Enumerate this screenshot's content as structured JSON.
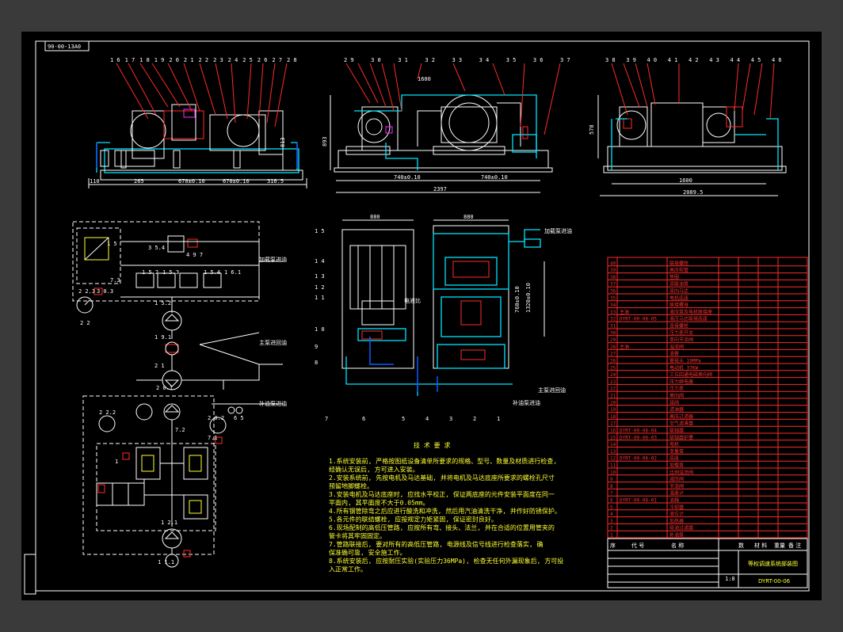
{
  "drawing": {
    "code_tag": "90-00-13A0",
    "title": "等权调速系统部装图",
    "number": "DYRT-00-06",
    "scale": "1:8"
  },
  "views": {
    "front_labels": [
      "1 6",
      "1 7",
      "1 8",
      "1 9",
      "2 0",
      "2 1",
      "2 2",
      "2 3",
      "2 4",
      "2 5",
      "2 6",
      "2 7",
      "2 8"
    ],
    "front_dims": [
      "110",
      "265",
      "670±0.10",
      "670±0.10",
      "316.5"
    ],
    "front_height": "813",
    "side_labels": [
      "2 9",
      "3 0",
      "3 1",
      "3 2",
      "3 3",
      "3 4",
      "3 5",
      "3 6",
      "3 7"
    ],
    "side_dims": [
      "1600",
      "740±0.10",
      "740±0.10",
      "2397"
    ],
    "side_height": "893",
    "right_labels": [
      "3 8",
      "3 9",
      "4 0",
      "4 1",
      "4 2",
      "4 3",
      "4 4",
      "4 5",
      "4 6"
    ],
    "right_dims": [
      "1600",
      "2089.5"
    ],
    "right_height": "578",
    "top_dims": [
      "880",
      "880"
    ],
    "plan_labels": [
      "1 5",
      "1 4",
      "1 3",
      "1 2",
      "1 1",
      "1 0",
      "9",
      "8",
      "7",
      "6",
      "5",
      "4",
      "3",
      "2",
      "1"
    ],
    "plan_notes": [
      "加载泵进油",
      "电液比",
      "主泵进回油",
      "补油泵进油"
    ]
  },
  "schematic": {
    "labels": [
      "1 5",
      "3 5.4",
      "4 9 7",
      "1 5.2",
      "1 5.3",
      "1 5.4",
      "1 6.1",
      "7.3",
      "2 2.3",
      "3 0.3",
      "2 2",
      "1 5.2",
      "1 9.1",
      "2 1",
      "2 0.1",
      "2 2.2",
      "2 0.2",
      "7.2",
      "7.1",
      "1",
      "1 2.1",
      "1 1.1"
    ],
    "line_labels": [
      "加载泵进油",
      "主泵进回油",
      "补油泵进油"
    ],
    "valve_number": "6 5"
  },
  "notes": {
    "heading": "技 术 要 求",
    "items": [
      "1.系统安装前, 严格按图纸设备清单所要求的规格、型号、数量及材质进行检查,",
      "   经确认无误后, 方可进入安装。",
      "2.安装系统前, 先按电机及马达基础, 并将电机及马达底座所要求的螺栓孔尺寸",
      "   预留地脚螺栓。",
      "3.安装电机及马达底座时, 应找水平校正, 保证两底座的元件安装平面度在同一",
      "   平面内, 其平面度不大于0.05mm。",
      "4.所有钢管除弯之后应进行酸洗和冲洗, 然后用汽油清洗干净, 并作好防锈保护。",
      "5.各元件的联结螺栓, 应按规定力矩紧固, 保证密封良好。",
      "6.现场配制的高低压管路, 应按所有弯、接头、法兰, 并在合适的位置用管夹的",
      "   管卡将其牢固固定。",
      "7.管路联接后, 要对所有的高低压管路, 电源线及信号线进行检查落实, 确",
      "   保准确可靠, 安全施工作。",
      "8.系统安装后, 应按耐压实验(实验压力36MPa), 检查无任何外漏现象后, 方可投",
      "   入正常工作。"
    ]
  },
  "parts": {
    "rows": [
      {
        "no": "40",
        "code": "",
        "name": "联接螺栓"
      },
      {
        "no": "39",
        "code": "",
        "name": "高压软管"
      },
      {
        "no": "38",
        "code": "",
        "name": "垫圈"
      },
      {
        "no": "37",
        "code": "",
        "name": "双联油泵"
      },
      {
        "no": "36",
        "code": "",
        "name": "双向马达"
      },
      {
        "no": "35",
        "code": "",
        "name": "电机底座"
      },
      {
        "no": "34",
        "code": "",
        "name": "联接螺母"
      },
      {
        "no": "33",
        "code": "主油",
        "name": "液压泵及电机联接座"
      },
      {
        "no": "32",
        "code": "DYRT-00-06-05",
        "name": "液压马达联接底座"
      },
      {
        "no": "31",
        "code": "",
        "name": "连接螺栓"
      },
      {
        "no": "30",
        "code": "",
        "name": "压力表开关"
      },
      {
        "no": "29",
        "code": "",
        "name": "单向节流阀"
      },
      {
        "no": "28",
        "code": "主油",
        "name": "溢流阀"
      },
      {
        "no": "27",
        "code": "",
        "name": "油管"
      },
      {
        "no": "26",
        "code": "",
        "name": "管接头 10MPa"
      },
      {
        "no": "25",
        "code": "",
        "name": "电动机 37KW"
      },
      {
        "no": "24",
        "code": "",
        "name": "三位四通电磁换向阀"
      },
      {
        "no": "23",
        "code": "",
        "name": "压力继电器"
      },
      {
        "no": "22",
        "code": "",
        "name": "压力表"
      },
      {
        "no": "21",
        "code": "",
        "name": "单向阀"
      },
      {
        "no": "20",
        "code": "",
        "name": "球阀"
      },
      {
        "no": "19",
        "code": "",
        "name": "滤油器"
      },
      {
        "no": "18",
        "code": "",
        "name": "高压过滤器"
      },
      {
        "no": "17",
        "code": "",
        "name": "空气滤清器"
      },
      {
        "no": "16",
        "code": "DYRT-00-06-04",
        "name": "联轴器"
      },
      {
        "no": "15",
        "code": "DYRT-00-06-03",
        "name": "联轴器护罩"
      },
      {
        "no": "14",
        "code": "",
        "name": "电机"
      },
      {
        "no": "13",
        "code": "",
        "name": "变量泵"
      },
      {
        "no": "12",
        "code": "DYRT-00-06-02",
        "name": "底座"
      },
      {
        "no": "11",
        "code": "",
        "name": "加载泵"
      },
      {
        "no": "10",
        "code": "",
        "name": "比例溢流阀"
      },
      {
        "no": "9",
        "code": "",
        "name": "减压阀"
      },
      {
        "no": "8",
        "code": "",
        "name": "节流阀"
      },
      {
        "no": "7",
        "code": "",
        "name": "温度计"
      },
      {
        "no": "6",
        "code": "DYRT-00-06-01",
        "name": "油箱"
      },
      {
        "no": "5",
        "code": "",
        "name": "冷却器"
      },
      {
        "no": "4",
        "code": "",
        "name": "液位计"
      },
      {
        "no": "3",
        "code": "",
        "name": "加热器"
      },
      {
        "no": "2",
        "code": "",
        "name": "吸油过滤器"
      },
      {
        "no": "1",
        "code": "",
        "name": "补油泵"
      }
    ],
    "headers": [
      "序",
      "代 号",
      "名 称",
      "数",
      "材 料",
      "重量",
      "备 注"
    ]
  }
}
